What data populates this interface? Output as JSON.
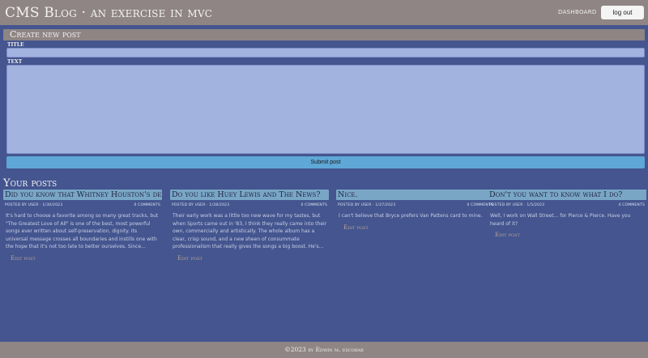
{
  "header": {
    "site_title": "CMS Blog · an exercise in mvc",
    "nav_dashboard": "dashboard",
    "logout_label": "log out"
  },
  "create_post": {
    "heading": "Create new post",
    "title_label": "title",
    "title_value": "",
    "text_label": "text",
    "text_value": "",
    "submit_label": "Submit post"
  },
  "your_posts": {
    "heading": "Your posts",
    "posts": [
      {
        "title": "Did you know that Whitney Houston's debut...",
        "meta_left": "posted by user · 1/30/2023",
        "meta_right": "0 comments",
        "body": "It's hard to choose a favorite among so many great tracks, but \"The Greatest Love of All\" is one of the best, most powerful songs ever written about self-preservation, dignity. Its universal message crosses all boundaries and instills one with the hope that it's not too late to better ourselves. Since...",
        "edit_label": "Edit post"
      },
      {
        "title": "Do you like Huey Lewis and The News?",
        "meta_left": "posted by user · 1/28/2023",
        "meta_right": "0 comments",
        "body": "Their early work was a little too new wave for my tastes, but when Sports came out in '83, I think they really came into their own, commercially and artistically. The whole album has a clear, crisp sound, and a new sheen of consummate professionalism that really gives the songs a big boost. He's...",
        "edit_label": "Edit post"
      },
      {
        "title": "Nice.",
        "meta_left": "posted by user · 1/27/2023",
        "meta_right": "0 comments",
        "body": "I can't believe that Bryce prefers Van Pattens card to mine.",
        "edit_label": "Edit post"
      },
      {
        "title": "Don't you want to know what I do?",
        "meta_left": "posted by user · 1/5/2023",
        "meta_right": "4 comments",
        "body": "Well, I work on Wall Street... for Pierce & Pierce. Have you heard of it?",
        "edit_label": "Edit post"
      }
    ]
  },
  "footer": {
    "text": "©2023 by Edwin m. escobar"
  }
}
